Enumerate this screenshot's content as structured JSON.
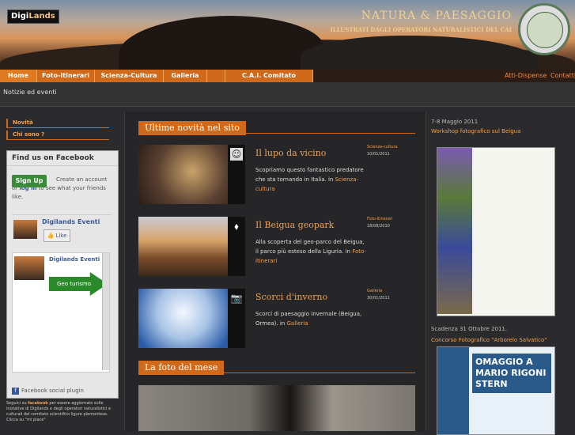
{
  "header": {
    "logo": {
      "prefix": "Digi",
      "suffix": "Lands"
    },
    "brand_title": "NATURA & PAESAGGIO",
    "brand_subtitle": "ILLUSTRATI DAGLI OPERATORI NATURALISTICI DEL CAI"
  },
  "nav": {
    "items": [
      {
        "label": "Home"
      },
      {
        "label": "Foto-Itinerari"
      },
      {
        "label": "Scienza-Cultura"
      },
      {
        "label": "Galleria"
      },
      {
        "label": ""
      },
      {
        "label": "C.A.I. Comitato scientifico LP"
      }
    ],
    "right": [
      {
        "label": "Atti-Dispense"
      },
      {
        "label": "Contatti"
      }
    ]
  },
  "subnav": {
    "label": "Notizie ed eventi"
  },
  "sidebar": {
    "links": [
      {
        "label": "Novità"
      },
      {
        "label": "Chi sono ?"
      }
    ],
    "facebook": {
      "title": "Find us on Facebook",
      "signup": "Sign Up",
      "signup_text_a": "Create an account or",
      "signup_text_login": "log in",
      "signup_text_b": "to see what your friends like.",
      "page_name": "Digilands Eventi",
      "like": "Like",
      "feed_name": "Digilands Eventi",
      "geo_label": "Geo turismo",
      "footer": "Facebook social plugin"
    },
    "note": {
      "a": "Seguici su",
      "link": "facebook",
      "b": "per essere aggiornato sulle iniziative di Digilands e degli operatori naturalistici e culturali del comitato scientifico ligure piemontese. Clicca su \"mi piace\""
    }
  },
  "main": {
    "section_title": "Ultime novità nel sito",
    "posts": [
      {
        "title": "Il lupo da vicino",
        "category": "Scienza-cultura",
        "date": "10/01/2011",
        "desc": "Scopriamo questo fantastico predatore che sta tornando in Italia. in",
        "desc_link": "Scienza-cultura"
      },
      {
        "title": "Il Beigua geopark",
        "category": "Foto-Itinerari",
        "date": "18/08/2010",
        "desc": "Alla scoperta del geo-parco del Beigua, il parco più esteso della Liguria. in",
        "desc_link": "Foto-itinerari"
      },
      {
        "title": "Scorci d'inverno",
        "category": "Galleria",
        "date": "30/01/2011",
        "desc": "Scorci di paesaggio invernale (Beigua, Ormea). in",
        "desc_link": "Galleria"
      }
    ],
    "photo_title": "La foto del mese"
  },
  "right": {
    "event1_date": "7-8 Maggio 2011",
    "event1_link": "Workshop fotografico sul Beigua",
    "event2_date": "Scadenza 31 Ottobre 2011.",
    "event2_link": "Concorso Fotografico \"Arborelo Salvatico\"",
    "poster2_text": "OMAGGIO A MARIO RIGONI STERN"
  }
}
